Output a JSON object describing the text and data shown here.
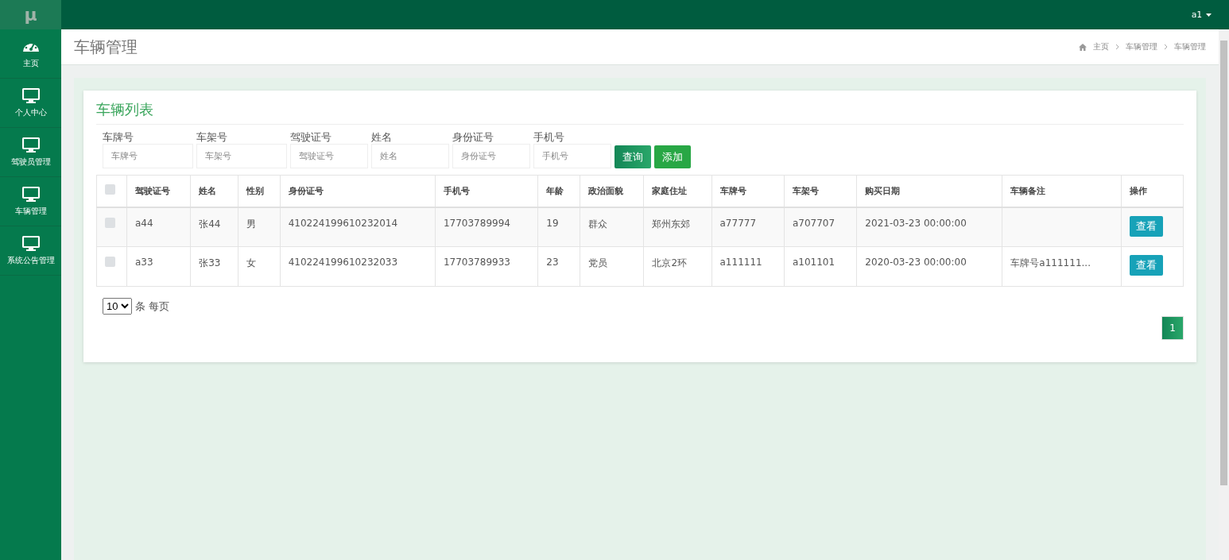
{
  "logo": "µ",
  "user_menu": {
    "label": "a1"
  },
  "sidebar": {
    "items": [
      {
        "label": "主页",
        "kind": "dashboard"
      },
      {
        "label": "个人中心",
        "kind": "monitor"
      },
      {
        "label": "驾驶员管理",
        "kind": "monitor"
      },
      {
        "label": "车辆管理",
        "kind": "monitor"
      },
      {
        "label": "系统公告管理",
        "kind": "monitor"
      }
    ]
  },
  "page_title": "车辆管理",
  "breadcrumb": [
    "主页",
    "车辆管理",
    "车辆管理"
  ],
  "card": {
    "title": "车辆列表",
    "filters": [
      {
        "label": "车牌号",
        "placeholder": "车牌号"
      },
      {
        "label": "车架号",
        "placeholder": "车架号"
      },
      {
        "label": "驾驶证号",
        "placeholder": "驾驶证号"
      },
      {
        "label": "姓名",
        "placeholder": "姓名"
      },
      {
        "label": "身份证号",
        "placeholder": "身份证号"
      },
      {
        "label": "手机号",
        "placeholder": "手机号"
      }
    ],
    "buttons": [
      {
        "label": "查询",
        "kind": "query"
      },
      {
        "label": "添加",
        "kind": "add"
      }
    ],
    "table": {
      "select_all": {
        "checked": false
      },
      "columns": [
        "驾驶证号",
        "姓名",
        "性别",
        "身份证号",
        "手机号",
        "年龄",
        "政治面貌",
        "家庭住址",
        "车牌号",
        "车架号",
        "购买日期",
        "车辆备注",
        "操作"
      ],
      "rows": [
        {
          "checked": false,
          "cells": [
            "a44",
            "张44",
            "男",
            "410224199610232014",
            "17703789994",
            "19",
            "群众",
            "郑州东郊",
            "a77777",
            "a707707",
            "2021-03-23 00:00:00",
            ""
          ],
          "action": "查看"
        },
        {
          "checked": false,
          "cells": [
            "a33",
            "张33",
            "女",
            "410224199610232033",
            "17703789933",
            "23",
            "党员",
            "北京2环",
            "a111111",
            "a101101",
            "2020-03-23 00:00:00",
            "车牌号a111111..."
          ],
          "action": "查看"
        }
      ]
    },
    "page_size": {
      "value": "10",
      "label": "条 每页"
    },
    "pagination": [
      {
        "label": "1",
        "selected": true
      }
    ]
  }
}
